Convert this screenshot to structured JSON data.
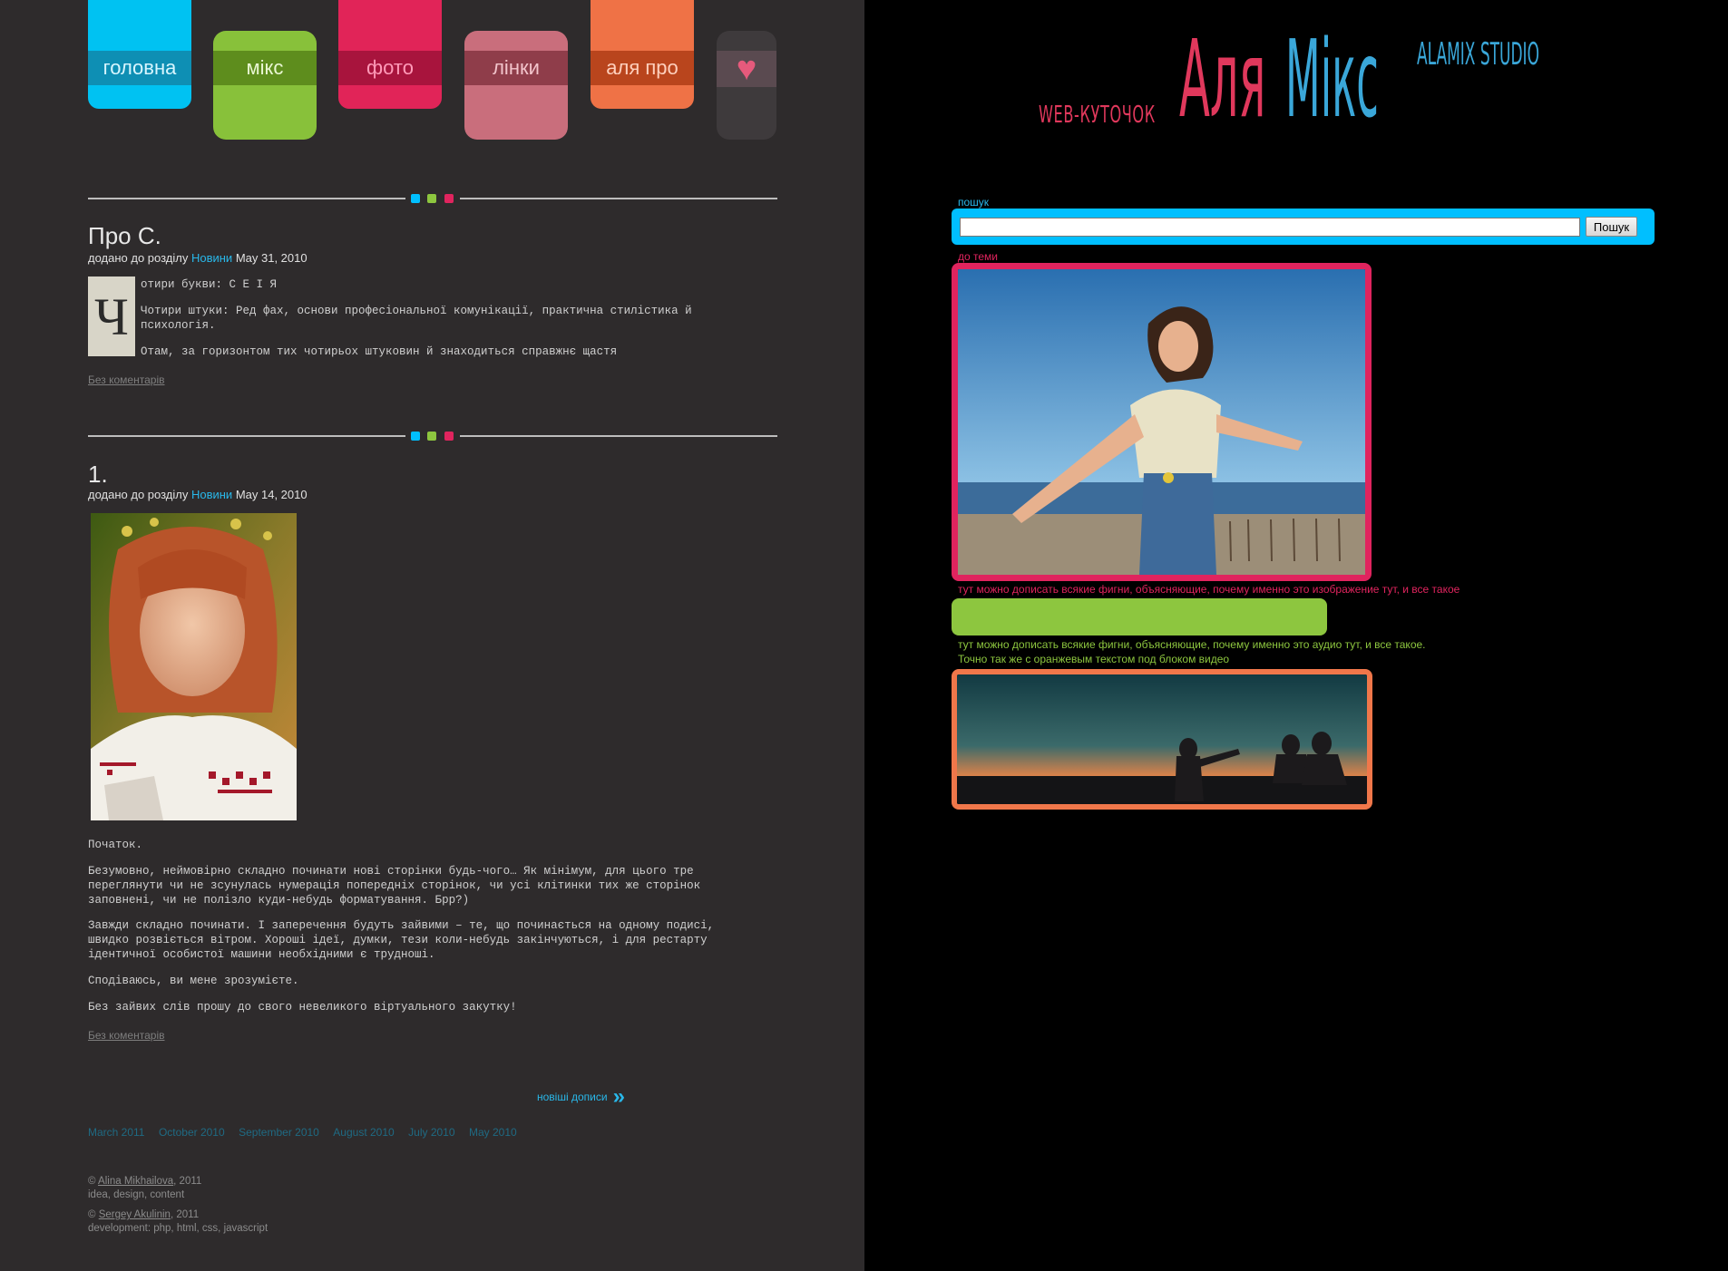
{
  "nav": {
    "tabs": [
      {
        "label": "головна",
        "color": "#00c2f2",
        "band_color": "#0e8fb4",
        "text_color": "#d8f6ff"
      },
      {
        "label": "мікс",
        "color": "#88c13a",
        "band_color": "#5e8d1d",
        "text_color": "#eaf7d4"
      },
      {
        "label": "фото",
        "color": "#e12458",
        "band_color": "#a8143d",
        "text_color": "#ff9ab8"
      },
      {
        "label": "лінки",
        "color": "#c96e7c",
        "band_color": "#8f3d4a",
        "text_color": "#f2c4cb"
      },
      {
        "label": "аля про",
        "color": "#ef7246",
        "band_color": "#b9451d",
        "text_color": "#ffd0bd"
      },
      {
        "label": "♥",
        "color": "#3e3a3c",
        "band_color": "#5a4a50",
        "text_color": "#e65a7c"
      }
    ]
  },
  "logo": {
    "prefix": "WEB-КУТОЧОК",
    "word1": "Аля",
    "word2": "Мікс",
    "studio": "ALAMIX STUDIO"
  },
  "posts": [
    {
      "title": "Про С.",
      "meta_prefix": "додано до розділу",
      "category": "Новини",
      "date": "May 31, 2010",
      "dropcap": "Ч",
      "paragraphs": [
        "отири букви: С Е І Я",
        "Чотири штуки: Ред фах, основи професіональної комунікації, практична стилістика й психологія.",
        "Отам, за горизонтом тих чотирьох штуковин й знаходиться справжнє щастя"
      ],
      "comments": "Без коментарів"
    },
    {
      "title": "1.",
      "meta_prefix": "додано до розділу",
      "category": "Новини",
      "date": "May 14, 2010",
      "paragraphs": [
        "Початок.",
        "Безумовно, неймовірно складно починати нові сторінки будь-чого… Як мінімум, для цього тре переглянути чи не зсунулась нумерація попередніх сторінок, чи усі клітинки тих же сторінок заповнені, чи не полізло куди-небудь форматування. Брр?)",
        "Завжди складно починати. І заперечення будуть зайвими – те, що починається на одному подисі, швидко розвіється вітром. Хороші ідеї, думки, тези коли-небудь закінчуються, і для рестарту ідентичної особистої машини необхідними є трудноші.",
        "Сподіваюсь, ви мене зрозумієте.",
        "Без зайвих слів прошу до свого невеликого віртуального закутку!"
      ],
      "comments": "Без коментарів"
    }
  ],
  "pagination": {
    "newer_label": "новіші дописи"
  },
  "archive": [
    "March 2011",
    "October 2010",
    "September 2010",
    "August 2010",
    "July 2010",
    "May 2010"
  ],
  "footer": {
    "credit1_name": "Alina Mikhailova",
    "credit1_year": ", 2011",
    "credit1_role": "idea, design, content",
    "credit2_name": "Sergey Akulinin",
    "credit2_year": ", 2011",
    "credit2_role": "development: php, html, css, javascript"
  },
  "sidebar": {
    "search_label": "пошук",
    "search_value": "",
    "search_button": "Пошук",
    "topic_label": "до теми",
    "image_caption": "тут можно дописать всякие фигни, объясняющие, почему именно это изображение тут, и все такое",
    "audio_caption": "тут можно дописать всякие фигни, объясняющие, почему именно это аудио тут, и все такое.",
    "video_caption": "Точно так же с оранжевым текстом под блоком видео"
  },
  "colors": {
    "cyan": "#00bfff",
    "green": "#8dc63f",
    "pink": "#e0245e",
    "orange": "#f0774a",
    "left_bg": "#2e2b2c",
    "right_bg": "#000000"
  }
}
